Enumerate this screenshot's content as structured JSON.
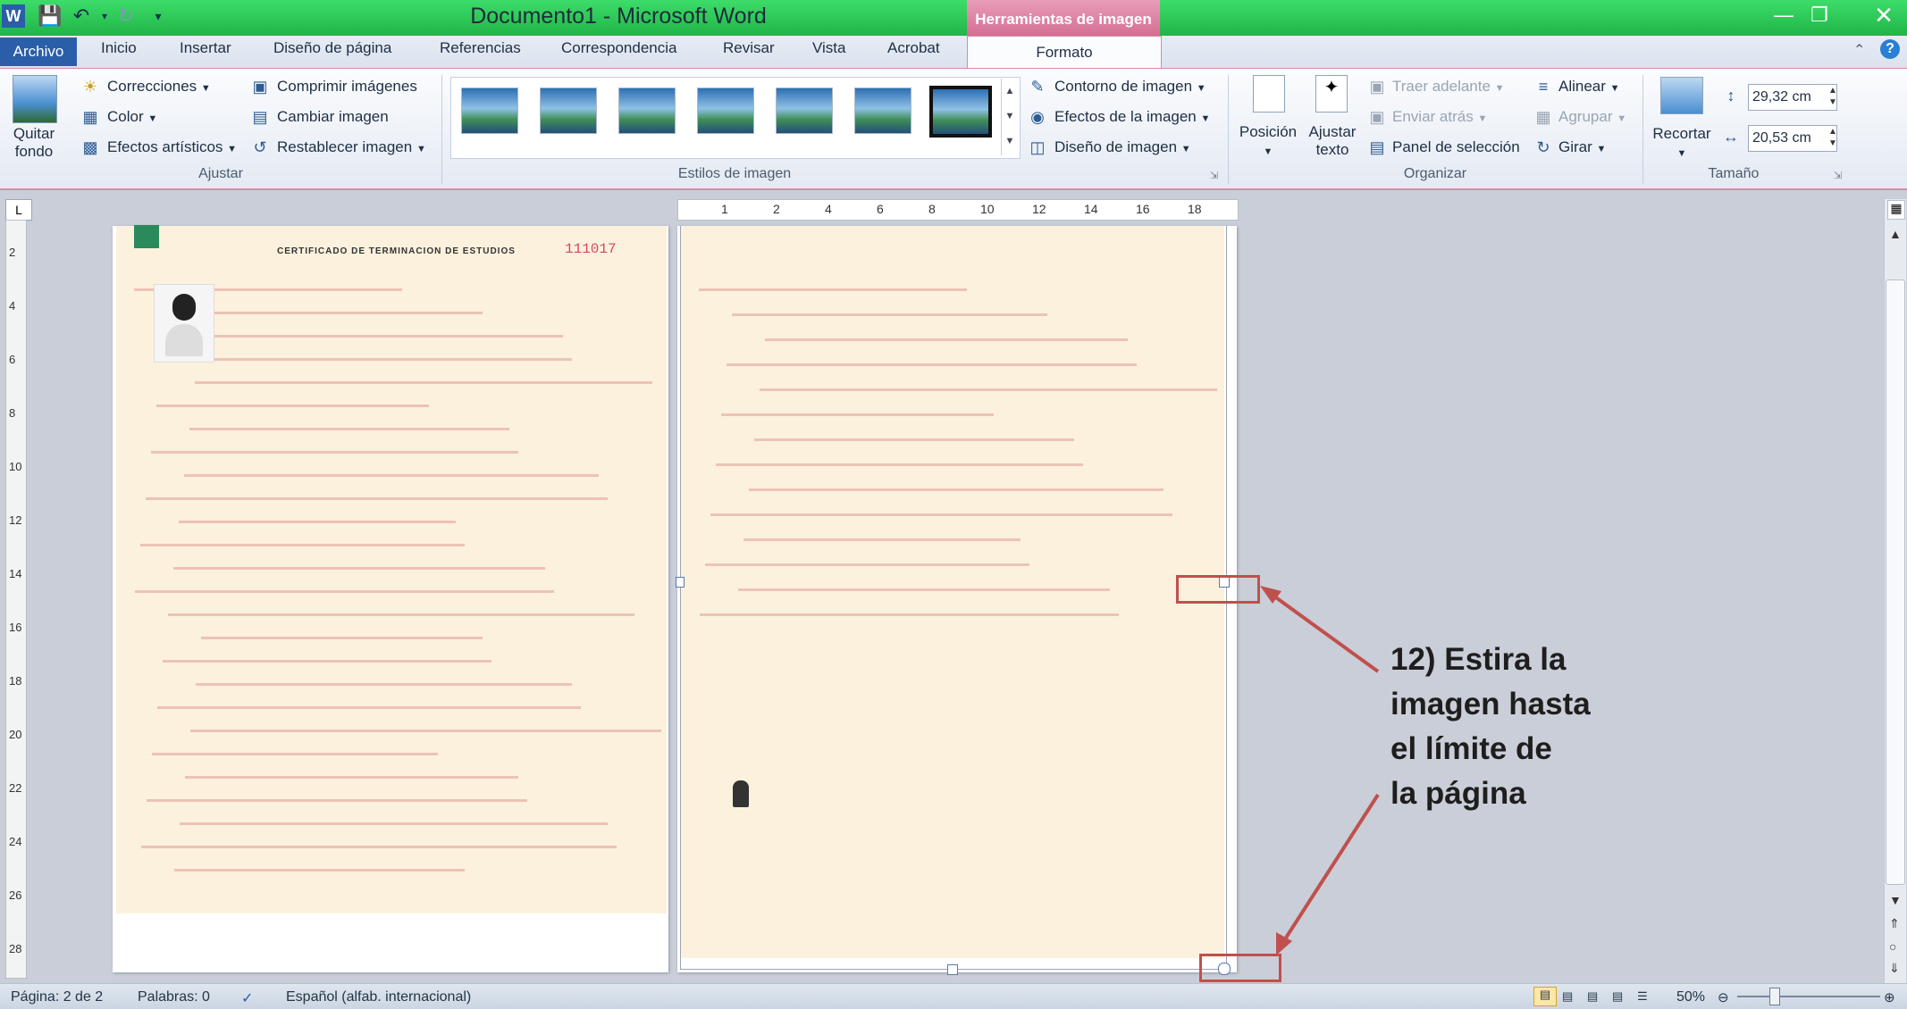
{
  "window": {
    "title": "Documento1 - Microsoft Word",
    "contextual_header": "Herramientas de imagen"
  },
  "tabs": [
    "Archivo",
    "Inicio",
    "Insertar",
    "Diseño de página",
    "Referencias",
    "Correspondencia",
    "Revisar",
    "Vista",
    "Acrobat",
    "Formato"
  ],
  "ribbon": {
    "ajustar": {
      "quitar_fondo": [
        "Quitar",
        "fondo"
      ],
      "correcciones": "Correcciones",
      "color": "Color",
      "efectos": "Efectos artísticos",
      "comprimir": "Comprimir imágenes",
      "cambiar": "Cambiar imagen",
      "restablecer": "Restablecer imagen",
      "label": "Ajustar"
    },
    "estilos": {
      "contorno": "Contorno de imagen",
      "efectos": "Efectos de la imagen",
      "diseno": "Diseño de imagen",
      "label": "Estilos de imagen"
    },
    "organizar": {
      "posicion": "Posición",
      "ajustar_texto": [
        "Ajustar",
        "texto"
      ],
      "traer": "Traer adelante",
      "enviar": "Enviar atrás",
      "panel": "Panel de selección",
      "alinear": "Alinear",
      "agrupar": "Agrupar",
      "girar": "Girar",
      "label": "Organizar"
    },
    "tamano": {
      "recortar": "Recortar",
      "alto": "29,32 cm",
      "ancho": "20,53 cm",
      "label": "Tamaño"
    }
  },
  "ruler": {
    "h_ticks": [
      "1",
      "2",
      "4",
      "6",
      "8",
      "10",
      "12",
      "14",
      "16",
      "18"
    ],
    "v_ticks": [
      "2",
      "4",
      "6",
      "8",
      "10",
      "12",
      "14",
      "16",
      "18",
      "20",
      "22",
      "24",
      "26",
      "28"
    ]
  },
  "document": {
    "left_page": {
      "header": "CERTIFICADO DE TERMINACION DE ESTUDIOS",
      "folio": "111017"
    }
  },
  "annotation": {
    "lines": [
      "12) Estira la",
      "imagen hasta",
      "el límite de",
      "la página"
    ],
    "color": "#c0504d"
  },
  "status": {
    "page": "Página: 2 de 2",
    "words": "Palabras: 0",
    "language": "Español (alfab. internacional)",
    "zoom": "50%"
  },
  "colors": {
    "accent": "#2a5ea8",
    "contextual": "#d56f94"
  }
}
